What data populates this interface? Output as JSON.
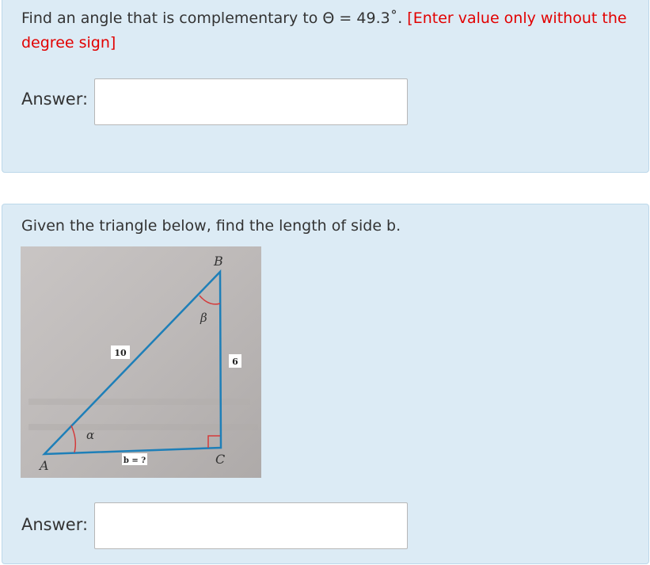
{
  "question1": {
    "text_main": "Find an angle that is complementary to Θ = 49.3˚.",
    "text_note": "[Enter value only without the degree sign]",
    "answer_label": "Answer:",
    "answer_value": ""
  },
  "question2": {
    "text": "Given the triangle below, find the length of side b.",
    "answer_label": "Answer:",
    "answer_value": "",
    "figure": {
      "vertex_a": "A",
      "vertex_b": "B",
      "vertex_c": "C",
      "angle_alpha": "α",
      "angle_beta": "β",
      "hypotenuse_label": "10",
      "side_bc_label": "6",
      "side_b_label": "b = ?"
    }
  }
}
